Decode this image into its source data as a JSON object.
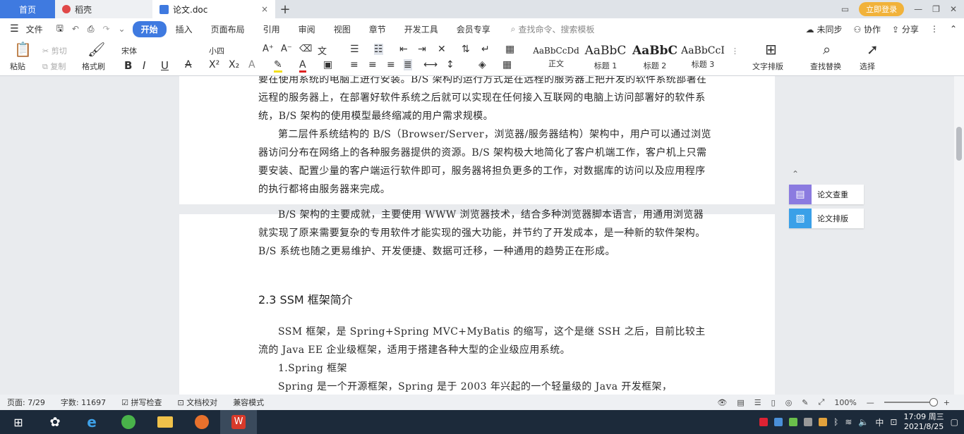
{
  "titlebar": {
    "tabs": [
      {
        "label": "首页"
      },
      {
        "label": "稻壳"
      },
      {
        "label": "论文.doc"
      }
    ],
    "login_label": "立即登录"
  },
  "menubar": {
    "file_label": "文件",
    "items": [
      "开始",
      "插入",
      "页面布局",
      "引用",
      "审阅",
      "视图",
      "章节",
      "开发工具",
      "会员专享"
    ],
    "search_placeholder": "查找命令、搜索模板",
    "sync_label": "未同步",
    "collab_label": "协作",
    "share_label": "分享"
  },
  "ribbon": {
    "paste_label": "粘贴",
    "cut_label": "剪切",
    "copy_label": "复制",
    "format_painter_label": "格式刷",
    "font_name": "宋体",
    "font_size": "小四",
    "styles": [
      {
        "sample": "AaBbCcDd",
        "name": "正文"
      },
      {
        "sample": "AaBbC",
        "name": "标题 1"
      },
      {
        "sample": "AaBbC",
        "name": "标题 2"
      },
      {
        "sample": "AaBbCcI",
        "name": "标题 3"
      }
    ],
    "text_layout_label": "文字排版",
    "find_replace_label": "查找替换",
    "select_label": "选择"
  },
  "document": {
    "page1_paragraphs": [
      "要在使用系统的电脑上进行安装。B/S 架构的运行方式是在远程的服务器上把开发的软件系统部署在远程的服务器上，在部署好软件系统之后就可以实现在任何接入互联网的电脑上访问部署好的软件系统，B/S 架构的使用模型最终缩减的用户需求规模。",
      "第二层件系统结构的 B/S（Browser/Server，浏览器/服务器结构）架构中，用户可以通过浏览器访问分布在网络上的各种服务器提供的资源。B/S 架构极大地简化了客户机端工作，客户机上只需要安装、配置少量的客户端运行软件即可，服务器将担负更多的工作，对数据库的访问以及应用程序的执行都将由服务器来完成。"
    ],
    "page2_paragraphs": [
      "B/S 架构的主要成就，主要使用 WWW 浏览器技术，结合多种浏览器脚本语言，用通用浏览器就实现了原来需要复杂的专用软件才能实现的强大功能，并节约了开发成本，是一种新的软件架构。B/S 系统也随之更易维护、开发便捷、数据可迁移，一种通用的趋势正在形成。"
    ],
    "heading": "2.3 SSM 框架简介",
    "page2_body": [
      "SSM 框架，是 Spring+Spring MVC+MyBatis 的缩写，这个是继 SSH 之后，目前比较主流的 Java EE 企业级框架，适用于搭建各种大型的企业级应用系统。",
      "1.Spring 框架",
      "Spring 是一个开源框架，Spring 是于 2003 年兴起的一个轻量级的 Java 开发框架，"
    ]
  },
  "side_panel": {
    "buttons": [
      {
        "label": "论文查重",
        "color": "#8b7be0"
      },
      {
        "label": "论文排版",
        "color": "#3aa0e8"
      }
    ]
  },
  "statusbar": {
    "page": "页面: 7/29",
    "words": "字数: 11697",
    "spellcheck": "拼写检查",
    "doc_proof": "文档校对",
    "compat_mode": "兼容模式",
    "zoom": "100%"
  },
  "taskbar": {
    "clock_time": "17:09 周三",
    "clock_date": "2021/8/25",
    "ime_label": "中"
  },
  "colors": {
    "accent": "#3f7ae0",
    "taskbar_bg": "#1c2a3a",
    "login": "#f1b23a"
  }
}
